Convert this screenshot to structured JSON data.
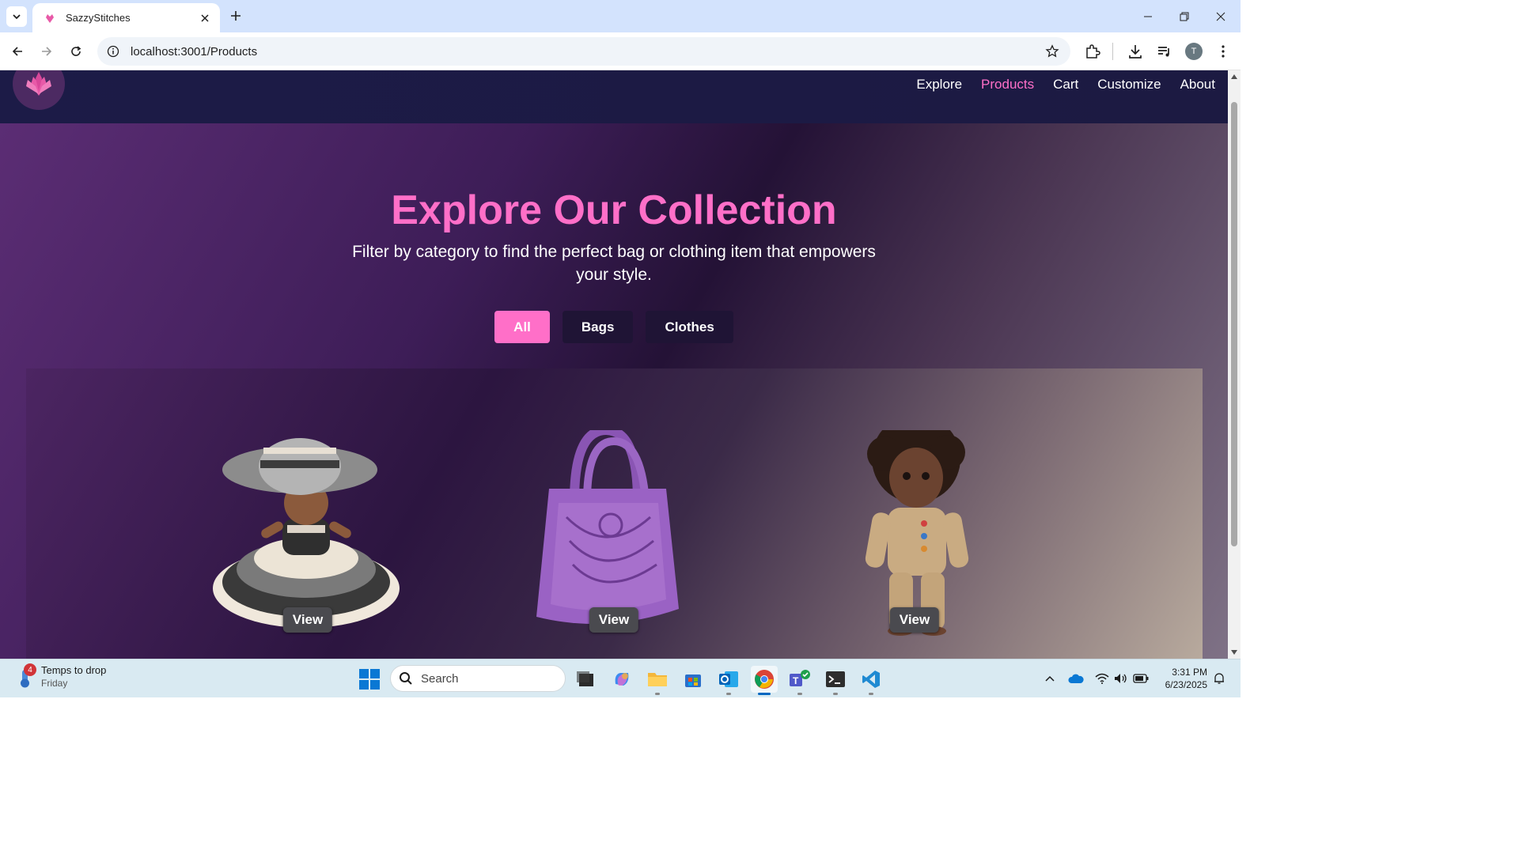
{
  "browser": {
    "tab_title": "SazzyStitches",
    "url": "localhost:3001/Products",
    "profile_initial": "T"
  },
  "site": {
    "nav": [
      {
        "label": "Explore",
        "active": false
      },
      {
        "label": "Products",
        "active": true
      },
      {
        "label": "Cart",
        "active": false
      },
      {
        "label": "Customize",
        "active": false
      },
      {
        "label": "About",
        "active": false
      }
    ],
    "hero": {
      "title": "Explore Our Collection",
      "subtitle": "Filter by category to find the perfect bag or clothing item that empowers your style."
    },
    "filters": [
      {
        "label": "All",
        "active": true
      },
      {
        "label": "Bags",
        "active": false
      },
      {
        "label": "Clothes",
        "active": false
      }
    ],
    "products": [
      {
        "name": "crochet-doll-hat-dress",
        "view_label": "View"
      },
      {
        "name": "purple-crochet-bag",
        "view_label": "View"
      },
      {
        "name": "doll-knit-outfit",
        "view_label": "View"
      }
    ],
    "accent_color": "#ff6fc8"
  },
  "taskbar": {
    "weather_title": "Temps to drop",
    "weather_sub": "Friday",
    "weather_badge": "4",
    "search_placeholder": "Search",
    "time": "3:31 PM",
    "date": "6/23/2025"
  }
}
